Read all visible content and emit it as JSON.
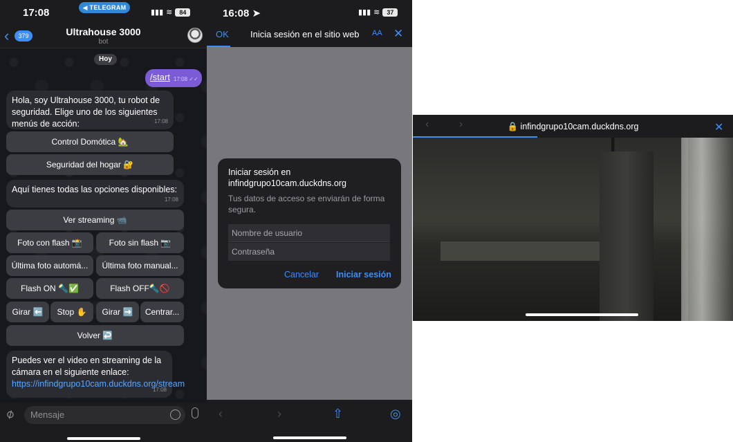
{
  "telegram": {
    "status": {
      "time": "17:08",
      "pill": "◀ TELEGRAM",
      "battery": "84"
    },
    "header": {
      "back_count": "379",
      "title": "Ultrahouse 3000",
      "subtitle": "bot"
    },
    "day_label": "Hoy",
    "outgoing": {
      "text": "/start",
      "time": "17:08"
    },
    "msg1": {
      "text": "Hola, soy Ultrahouse 3000, tu robot de seguridad. Elige uno de los siguientes menús de acción:",
      "time": "17:08"
    },
    "kb1": {
      "domotica": "Control Domótica 🏡",
      "seguridad": "Seguridad del hogar 🔐"
    },
    "msg2": {
      "text": "Aquí tienes todas las opciones disponibles:",
      "time": "17:08"
    },
    "kb2": {
      "streaming": "Ver streaming 📹",
      "foto_flash": "Foto con flash 📸",
      "foto_sin_flash": "Foto sin flash 📷",
      "ultima_auto": "Última foto automá...",
      "ultima_manual": "Última foto manual...",
      "flash_on": "Flash ON 🔦✅",
      "flash_off": "Flash OFF🔦🚫",
      "girar_izq": "Girar ⬅️",
      "stop": "Stop ✋",
      "girar_der": "Girar ➡️",
      "centrar": "Centrar...",
      "volver": "Volver ↩️"
    },
    "msg3": {
      "text": "Puedes ver el video en streaming de la cámara en el siguiente enlace: ",
      "link": "https://infindgrupo10cam.duckdns.org/stream",
      "time": "17:08"
    },
    "input_placeholder": "Mensaje"
  },
  "login": {
    "status": {
      "time": "16:08",
      "battery": "37"
    },
    "ok": "OK",
    "title": "Inicia sesión en el sitio web",
    "aa": "AA",
    "dialog": {
      "title": "Iniciar sesión en infindgrupo10cam.duckdns.org",
      "message": "Tus datos de acceso se enviarán de forma segura.",
      "username_placeholder": "Nombre de usuario",
      "password_placeholder": "Contraseña",
      "cancel": "Cancelar",
      "submit": "Iniciar sesión"
    }
  },
  "stream": {
    "url": "infindgrupo10cam.duckdns.org"
  },
  "colors": {
    "accent": "#3e8ef7",
    "outgoing_bubble": "#7b5bd6",
    "telegram_pill": "#2f88d8"
  }
}
